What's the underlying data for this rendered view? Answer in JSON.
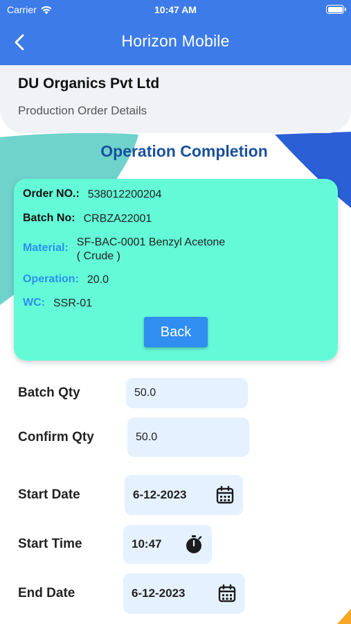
{
  "status_bar": {
    "carrier": "Carrier",
    "time": "10:47 AM"
  },
  "nav": {
    "title": "Horizon Mobile",
    "back_icon": "chevron-left-icon"
  },
  "header": {
    "company": "DU Organics Pvt Ltd",
    "subtitle": "Production Order Details"
  },
  "section_title": "Operation Completion",
  "info": {
    "order_label": "Order NO.:",
    "order_value": "538012200204",
    "batch_label": "Batch No:",
    "batch_value": "CRBZA22001",
    "material_label": "Material:",
    "material_value_line1": "SF-BAC-0001  Benzyl Acetone",
    "material_value_line2": "( Crude )",
    "operation_label": "Operation:",
    "operation_value": "20.0",
    "wc_label": "WC:",
    "wc_value": "SSR-01",
    "back_button": "Back"
  },
  "form": {
    "batch_qty_label": "Batch Qty",
    "batch_qty_value": "50.0",
    "confirm_qty_label": "Confirm Qty",
    "confirm_qty_value": "50.0",
    "start_date_label": "Start Date",
    "start_date_value": "6-12-2023",
    "start_time_label": "Start Time",
    "start_time_value": "10:47",
    "end_date_label": "End Date",
    "end_date_value": "6-12-2023"
  },
  "colors": {
    "nav_blue": "#3d7be8",
    "card_mint": "#64fad8",
    "label_blue": "#2a8ff0",
    "title_navy": "#1a4f9e",
    "field_bg": "#e5f1fe",
    "button_blue": "#2f8ef0"
  },
  "icons": [
    "wifi-icon",
    "battery-icon",
    "chevron-left-icon",
    "calendar-icon",
    "stopwatch-icon"
  ]
}
